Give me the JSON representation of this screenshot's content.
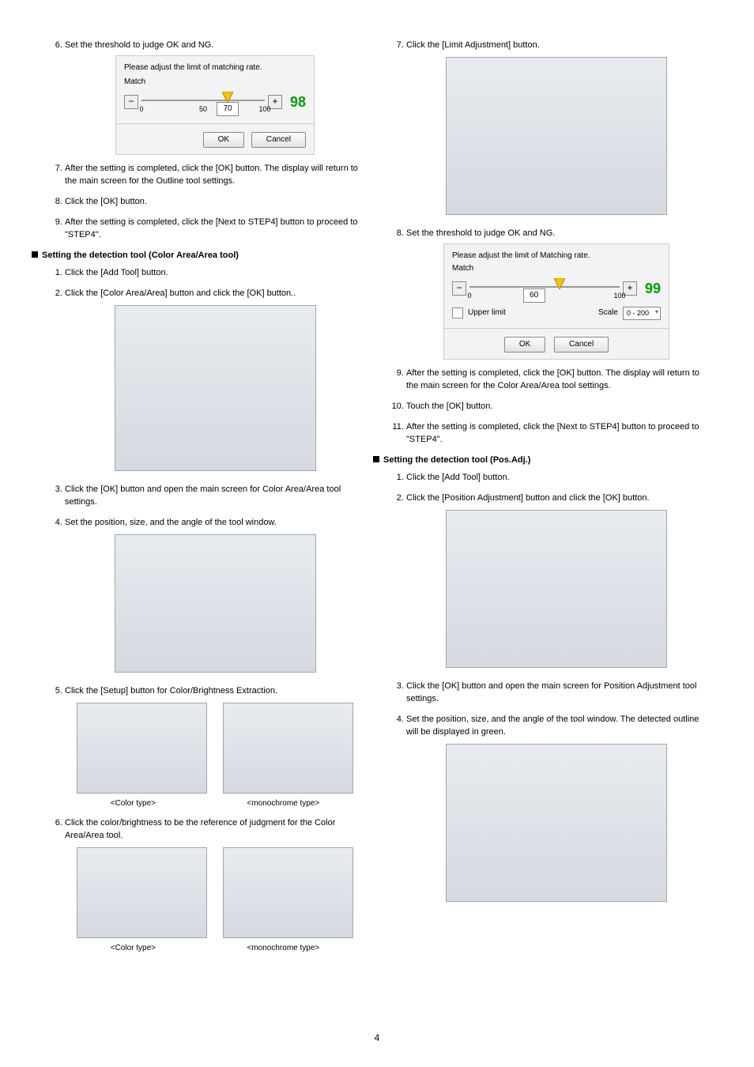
{
  "left": {
    "s6": "Set the threshold to judge OK and NG.",
    "limit": {
      "title": "Please adjust the limit of matching rate.",
      "match": "Match",
      "min": "0",
      "mid": "50",
      "max": "100",
      "value": "70",
      "big": "98",
      "ok": "OK",
      "cancel": "Cancel"
    },
    "s7": "After the setting is completed, click the [OK] button. The display will return to the main screen for the Outline tool settings.",
    "s8": "Click the [OK] button.",
    "s9": "After the setting is completed, click the [Next to STEP4] button to proceed to \"STEP4\".",
    "hColor": "Setting the detection tool (Color Area/Area tool)",
    "c1": "Click the [Add Tool] button.",
    "c2": "Click the [Color Area/Area] button and click the [OK] button..",
    "c3": "Click the [OK] button and open the main screen for Color Area/Area tool settings.",
    "c4": "Set the position, size, and the angle of the tool window.",
    "c5": "Click the [Setup] button for Color/Brightness Extraction.",
    "c6": "Click the color/brightness to be the reference of judgment for the Color Area/Area tool.",
    "capColor": "<Color type>",
    "capMono": "<monochrome type>"
  },
  "right": {
    "s7": "Click the [Limit Adjustment] button.",
    "s8": "Set the threshold to judge OK and NG.",
    "limit": {
      "title": "Please adjust the limit of Matching rate.",
      "match": "Match",
      "min": "0",
      "mid": "60",
      "max": "100",
      "value": "60",
      "big": "99",
      "upper": "Upper limit",
      "scale": "Scale",
      "scaleRange": "0 - 200",
      "ok": "OK",
      "cancel": "Cancel"
    },
    "s9": "After the setting is completed, click the [OK] button. The display will return to the main screen for the Color Area/Area tool settings.",
    "s10": "Touch the [OK] button.",
    "s11": "After the setting is completed, click the [Next to STEP4] button to proceed to \"STEP4\".",
    "hPos": "Setting the detection tool (Pos.Adj.)",
    "p1": "Click the [Add Tool] button.",
    "p2": "Click the [Position Adjustment] button and click the [OK] button.",
    "p3": "Click the [OK] button and open the main screen for Position Adjustment tool settings.",
    "p4": "Set the position, size, and the angle of the tool window. The detected outline will be displayed in green."
  },
  "pageNumber": "4"
}
